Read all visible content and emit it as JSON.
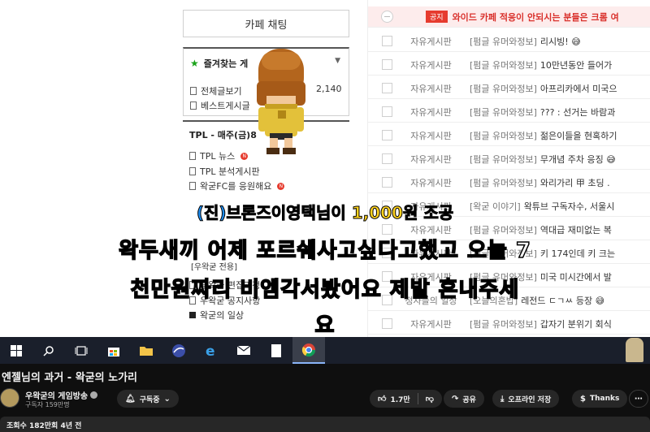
{
  "sidebar": {
    "chat_button": "카페 채팅",
    "favorites_title": "즐겨찾는 게",
    "links": [
      "전체글보기",
      "베스트게시글"
    ],
    "count": "2,140",
    "tpl_title": "TPL - 매주(금)8",
    "tpl_links": [
      "TPL 뉴스",
      "TPL 분석게시판",
      "왁굳FC를 응원해요"
    ],
    "bracket_title": "[우왁굳 전용]",
    "lower_links": [
      "우왁굳 편집과정",
      "우왁굳 공지사항",
      "왁굳의 일상"
    ]
  },
  "board": {
    "notice": {
      "badge": "공지",
      "title": "와이드 카페 적응이 안되시는 분들은 크롬 여"
    },
    "rows": [
      {
        "category": "자유게시판",
        "tag": "[펌글 유머와정보]",
        "title": "리시빙! 😅"
      },
      {
        "category": "자유게시판",
        "tag": "[펌글 유머와정보]",
        "title": "10만년동안 들어가"
      },
      {
        "category": "자유게시판",
        "tag": "[펌글 유머와정보]",
        "title": "아프리카에서 미국으"
      },
      {
        "category": "자유게시판",
        "tag": "[펌글 유머와정보]",
        "title": "??? : 선거는 바람과"
      },
      {
        "category": "자유게시판",
        "tag": "[펌글 유머와정보]",
        "title": "젊은이들을 현혹하기"
      },
      {
        "category": "자유게시판",
        "tag": "[펌글 유머와정보]",
        "title": "무개념 주차 응징 😅"
      },
      {
        "category": "자유게시판",
        "tag": "[펌글 유머와정보]",
        "title": "와리가리 甲 초딩 ."
      },
      {
        "category": "자유게시판",
        "tag": "[왁굳 이야기]",
        "title": "왁튜브 구독자수, 서울시"
      },
      {
        "category": "자유게시판",
        "tag": "[펌글 유머와정보]",
        "title": "역대급 재미없는 복"
      },
      {
        "category": "자유게시판",
        "tag": "[펌글 유머와정보]",
        "title": "키 174인데 키 크는"
      },
      {
        "category": "자유게시판",
        "tag": "[펌글 유머와정보]",
        "title": "미국 미시간에서 발"
      },
      {
        "category": "정자들의 일상",
        "tag": "[오늘의혼밥]",
        "title": "레전드 ㄷㄱㅆ 등장 😅"
      },
      {
        "category": "자유게시판",
        "tag": "[펌글 유머와정보]",
        "title": "갑자기 분위기 회식"
      }
    ]
  },
  "subtitles": {
    "donation_name": "(진)브론즈이영택",
    "donation_mid": "님이 ",
    "donation_amount": "1,000원",
    "donation_end": " 조공",
    "line1": "왁두새끼 어제 포르쉐사고싶다고했고 오늘 7",
    "line2": "천만원짜리 비엠각서봤어요 제발 혼내주세",
    "line3": "요"
  },
  "taskbar": {
    "icons": [
      "windows-start",
      "search",
      "task-view",
      "store",
      "folder",
      "sphere",
      "edge",
      "mail",
      "document",
      "chrome"
    ],
    "active": "chrome"
  },
  "video": {
    "title": "엔젤님의 과거 - 왁굳의 노가리",
    "channel_name": "우왁굳의 게임방송",
    "subscribers": "구독자 159만명",
    "subscribe_label": "구독중",
    "like_count": "1.7만",
    "share_label": "공유",
    "offline_label": "오프라인 저장",
    "thanks_label": "Thanks",
    "views_line": "조회수 182만회  4년 전"
  },
  "colors": {
    "notice_red": "#e63b2e",
    "donation_name": "#1e8ff5",
    "donation_amount": "#ffd21f",
    "youtube_bg": "#0f0f0f"
  }
}
